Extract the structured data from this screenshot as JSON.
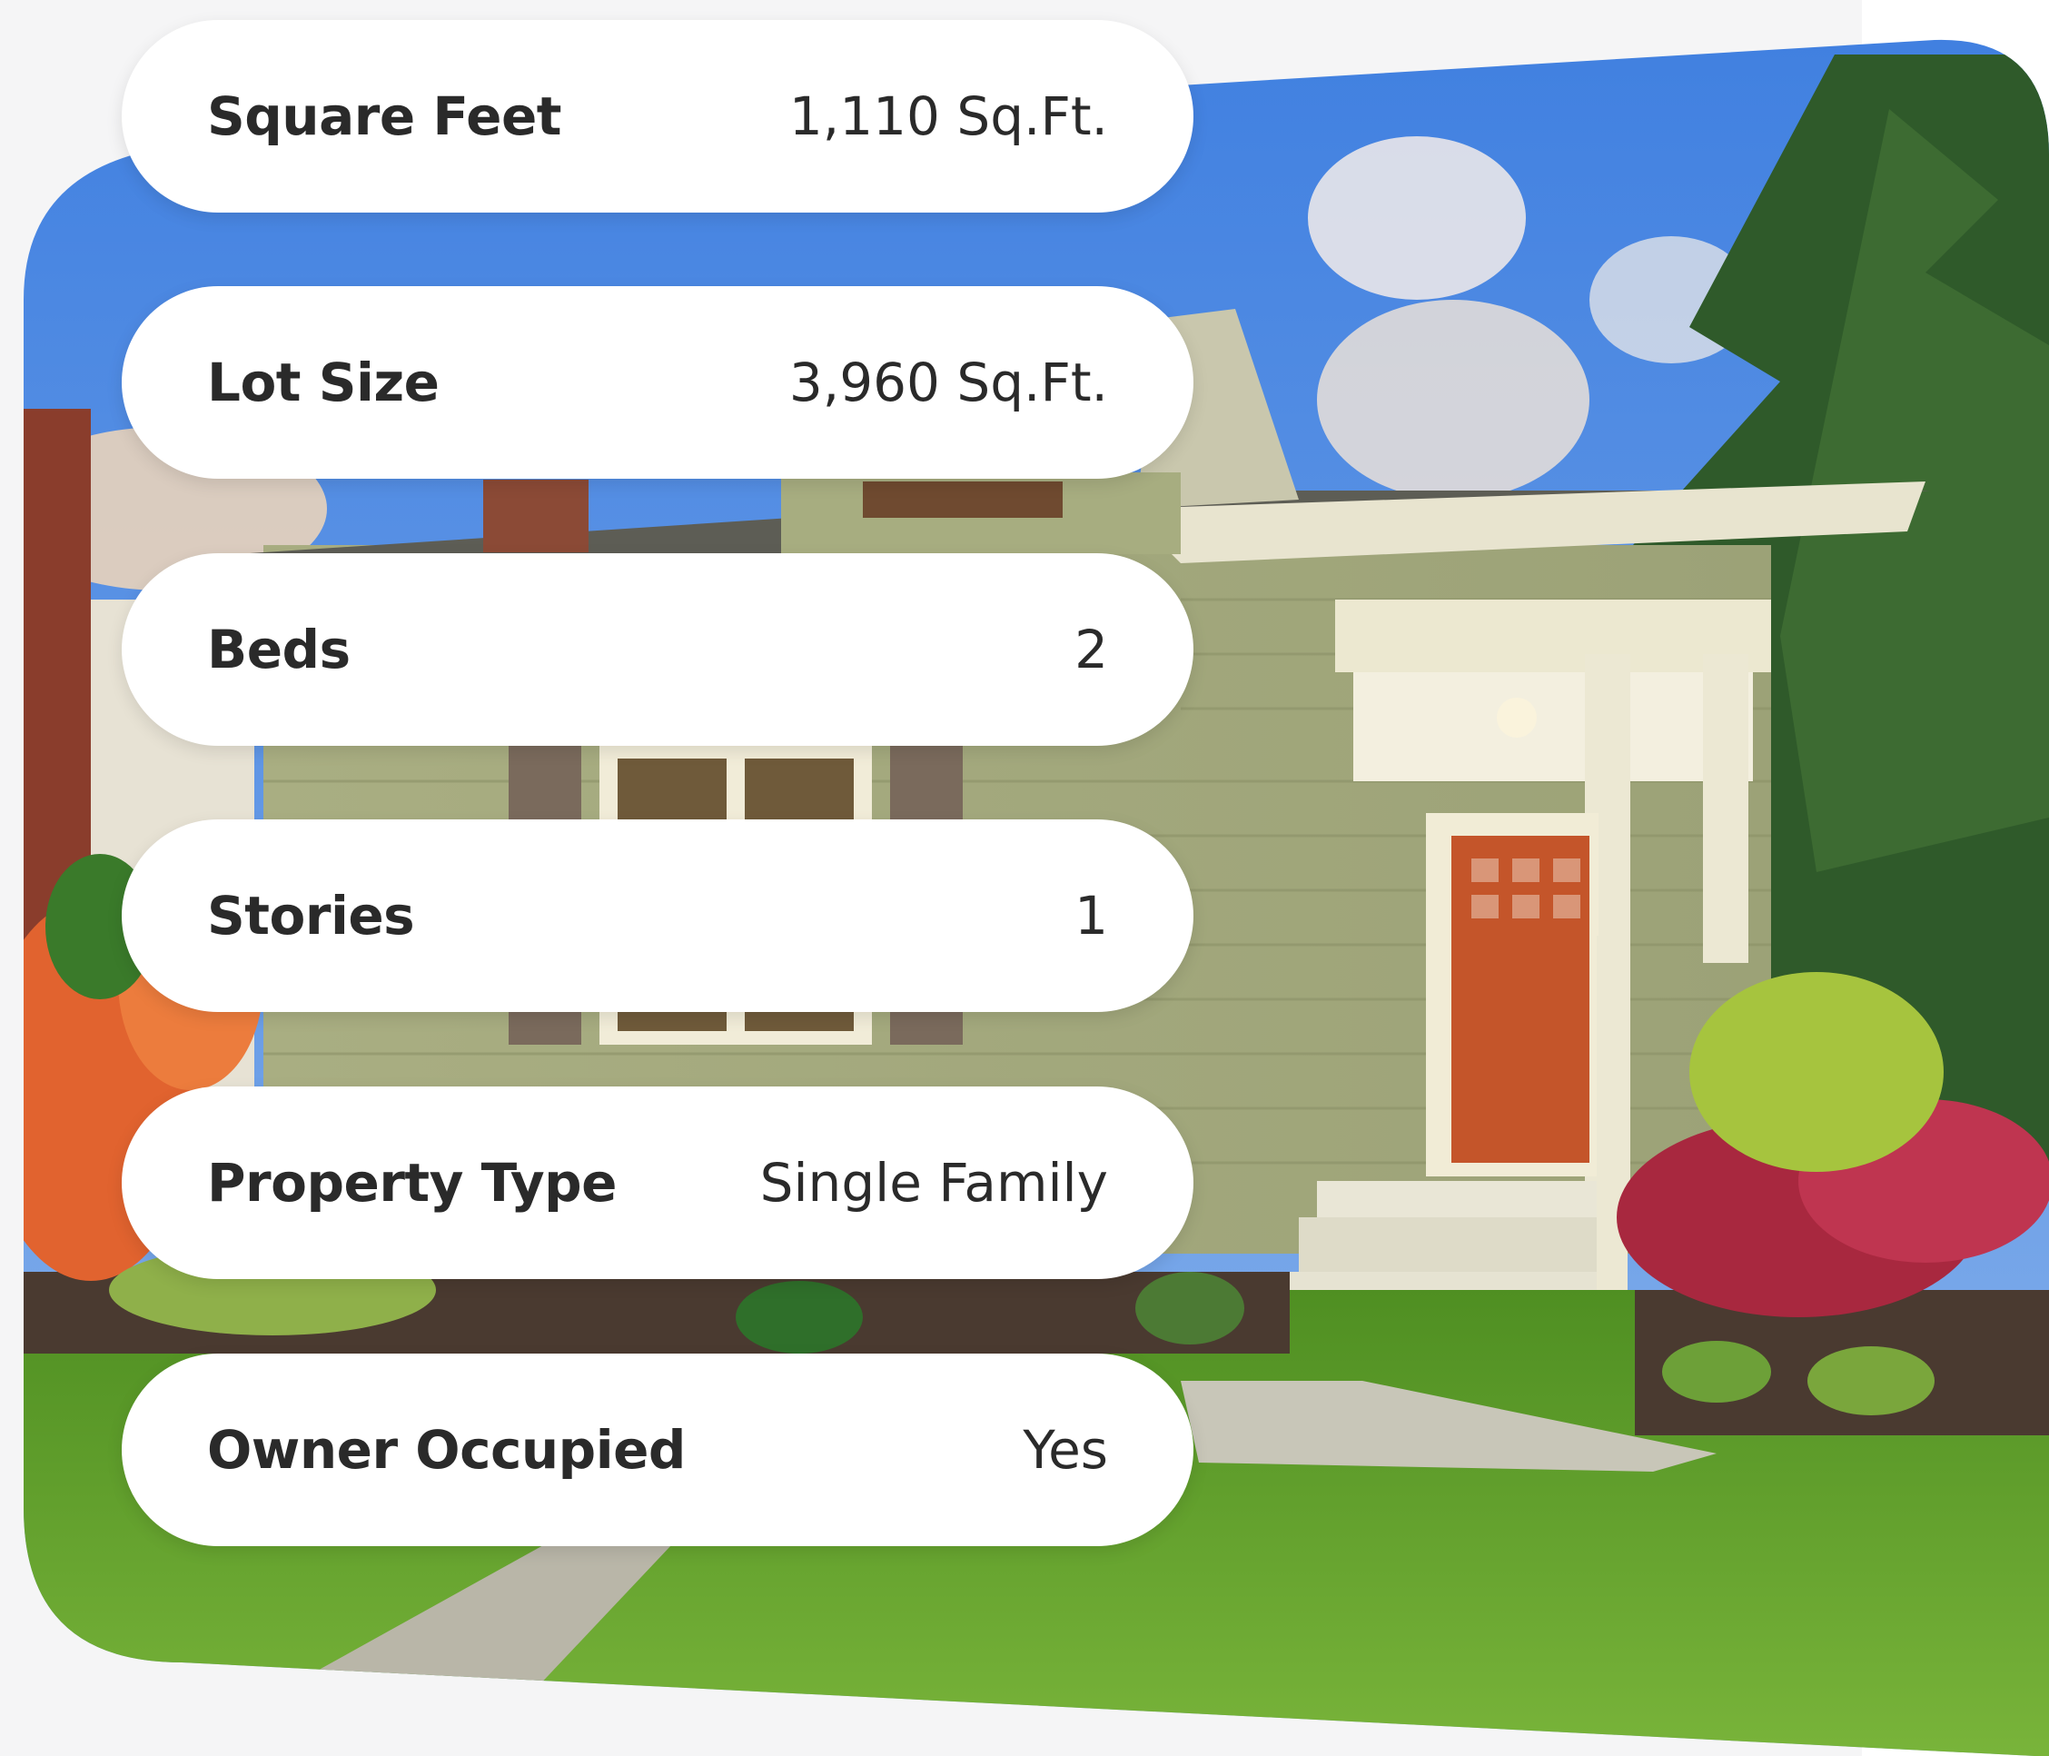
{
  "property_details": [
    {
      "label": "Square Feet",
      "value": "1,110 Sq.Ft."
    },
    {
      "label": "Lot Size",
      "value": "3,960 Sq.Ft."
    },
    {
      "label": "Beds",
      "value": "2"
    },
    {
      "label": "Stories",
      "value": "1"
    },
    {
      "label": "Property Type",
      "value": "Single Family"
    },
    {
      "label": "Owner Occupied",
      "value": "Yes"
    }
  ],
  "photo": {
    "subject": "house-photo"
  },
  "colors": {
    "pill_bg": "#ffffff",
    "text": "#2a2a2a",
    "sky": "#5b8fdc",
    "siding": "#a7ad7e",
    "door": "#c85a28",
    "grass": "#5f9b2e"
  }
}
